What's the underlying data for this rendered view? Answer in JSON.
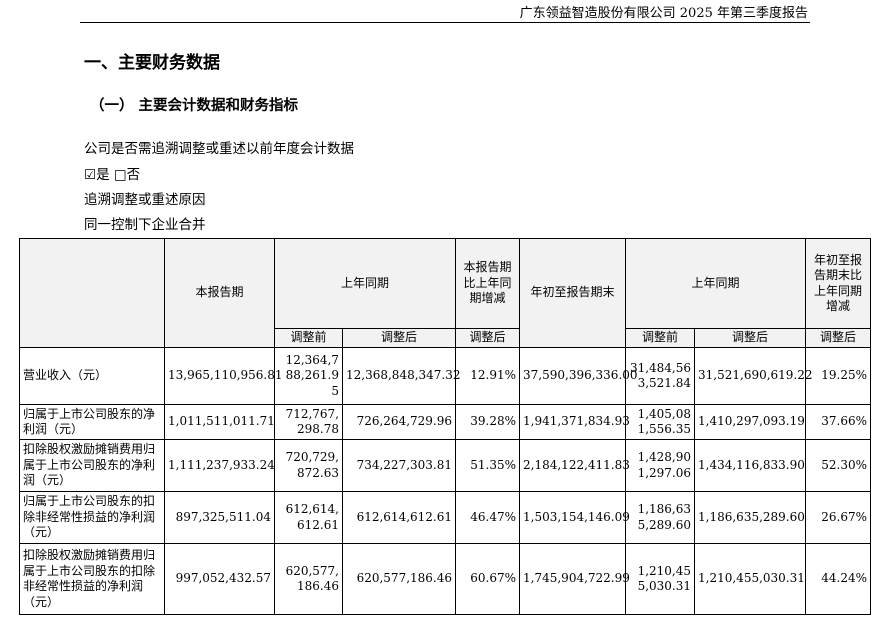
{
  "header": {
    "report_title": "广东领益智造股份有限公司 2025 年第三季度报告"
  },
  "section": {
    "title": "一、主要财务数据"
  },
  "subsection": {
    "title": "（一） 主要会计数据和财务指标"
  },
  "paragraphs": {
    "restate_question": "公司是否需追溯调整或重述以前年度会计数据",
    "checkbox_yes_symbol": "☑",
    "yes": "是",
    "checkbox_no_symbol": "□",
    "no": "否",
    "restate_reason_label": "追溯调整或重述原因",
    "restate_reason": "同一控制下企业合并"
  },
  "table": {
    "headers": {
      "current_period": "本报告期",
      "prior_period": "上年同期",
      "change": "本报告期比上年同期增减",
      "ytd": "年初至报告期末",
      "ytd_prior": "上年同期",
      "ytd_change": "年初至报告期末比上年同期增减",
      "before_adj": "调整前",
      "after_adj": "调整后",
      "change_after": "调整后",
      "ytd_before_adj": "调整前",
      "ytd_after_adj": "调整后",
      "ytd_change_after": "调整后"
    },
    "rows": [
      {
        "label": "营业收入（元）",
        "current": "13,965,110,956.81",
        "prior_before": "12,364,788,261.95",
        "prior_after": "12,368,848,347.32",
        "change": "12.91%",
        "ytd": "37,590,396,336.00",
        "ytd_prior_before": "31,484,563,521.84",
        "ytd_prior_after": "31,521,690,619.22",
        "ytd_change": "19.25%"
      },
      {
        "label": "归属于上市公司股东的净利润（元）",
        "current": "1,011,511,011.71",
        "prior_before": "712,767,298.78",
        "prior_after": "726,264,729.96",
        "change": "39.28%",
        "ytd": "1,941,371,834.93",
        "ytd_prior_before": "1,405,081,556.35",
        "ytd_prior_after": "1,410,297,093.19",
        "ytd_change": "37.66%"
      },
      {
        "label": "扣除股权激励摊销费用归属于上市公司股东的净利润（元）",
        "current": "1,111,237,933.24",
        "prior_before": "720,729,872.63",
        "prior_after": "734,227,303.81",
        "change": "51.35%",
        "ytd": "2,184,122,411.83",
        "ytd_prior_before": "1,428,901,297.06",
        "ytd_prior_after": "1,434,116,833.90",
        "ytd_change": "52.30%"
      },
      {
        "label": "归属于上市公司股东的扣除非经常性损益的净利润（元）",
        "current": "897,325,511.04",
        "prior_before": "612,614,612.61",
        "prior_after": "612,614,612.61",
        "change": "46.47%",
        "ytd": "1,503,154,146.09",
        "ytd_prior_before": "1,186,635,289.60",
        "ytd_prior_after": "1,186,635,289.60",
        "ytd_change": "26.67%"
      },
      {
        "label": "扣除股权激励摊销费用归属于上市公司股东的扣除非经常性损益的净利润（元）",
        "current": "997,052,432.57",
        "prior_before": "620,577,186.46",
        "prior_after": "620,577,186.46",
        "change": "60.67%",
        "ytd": "1,745,904,722.99",
        "ytd_prior_before": "1,210,455,030.31",
        "ytd_prior_after": "1,210,455,030.31",
        "ytd_change": "44.24%"
      }
    ]
  }
}
